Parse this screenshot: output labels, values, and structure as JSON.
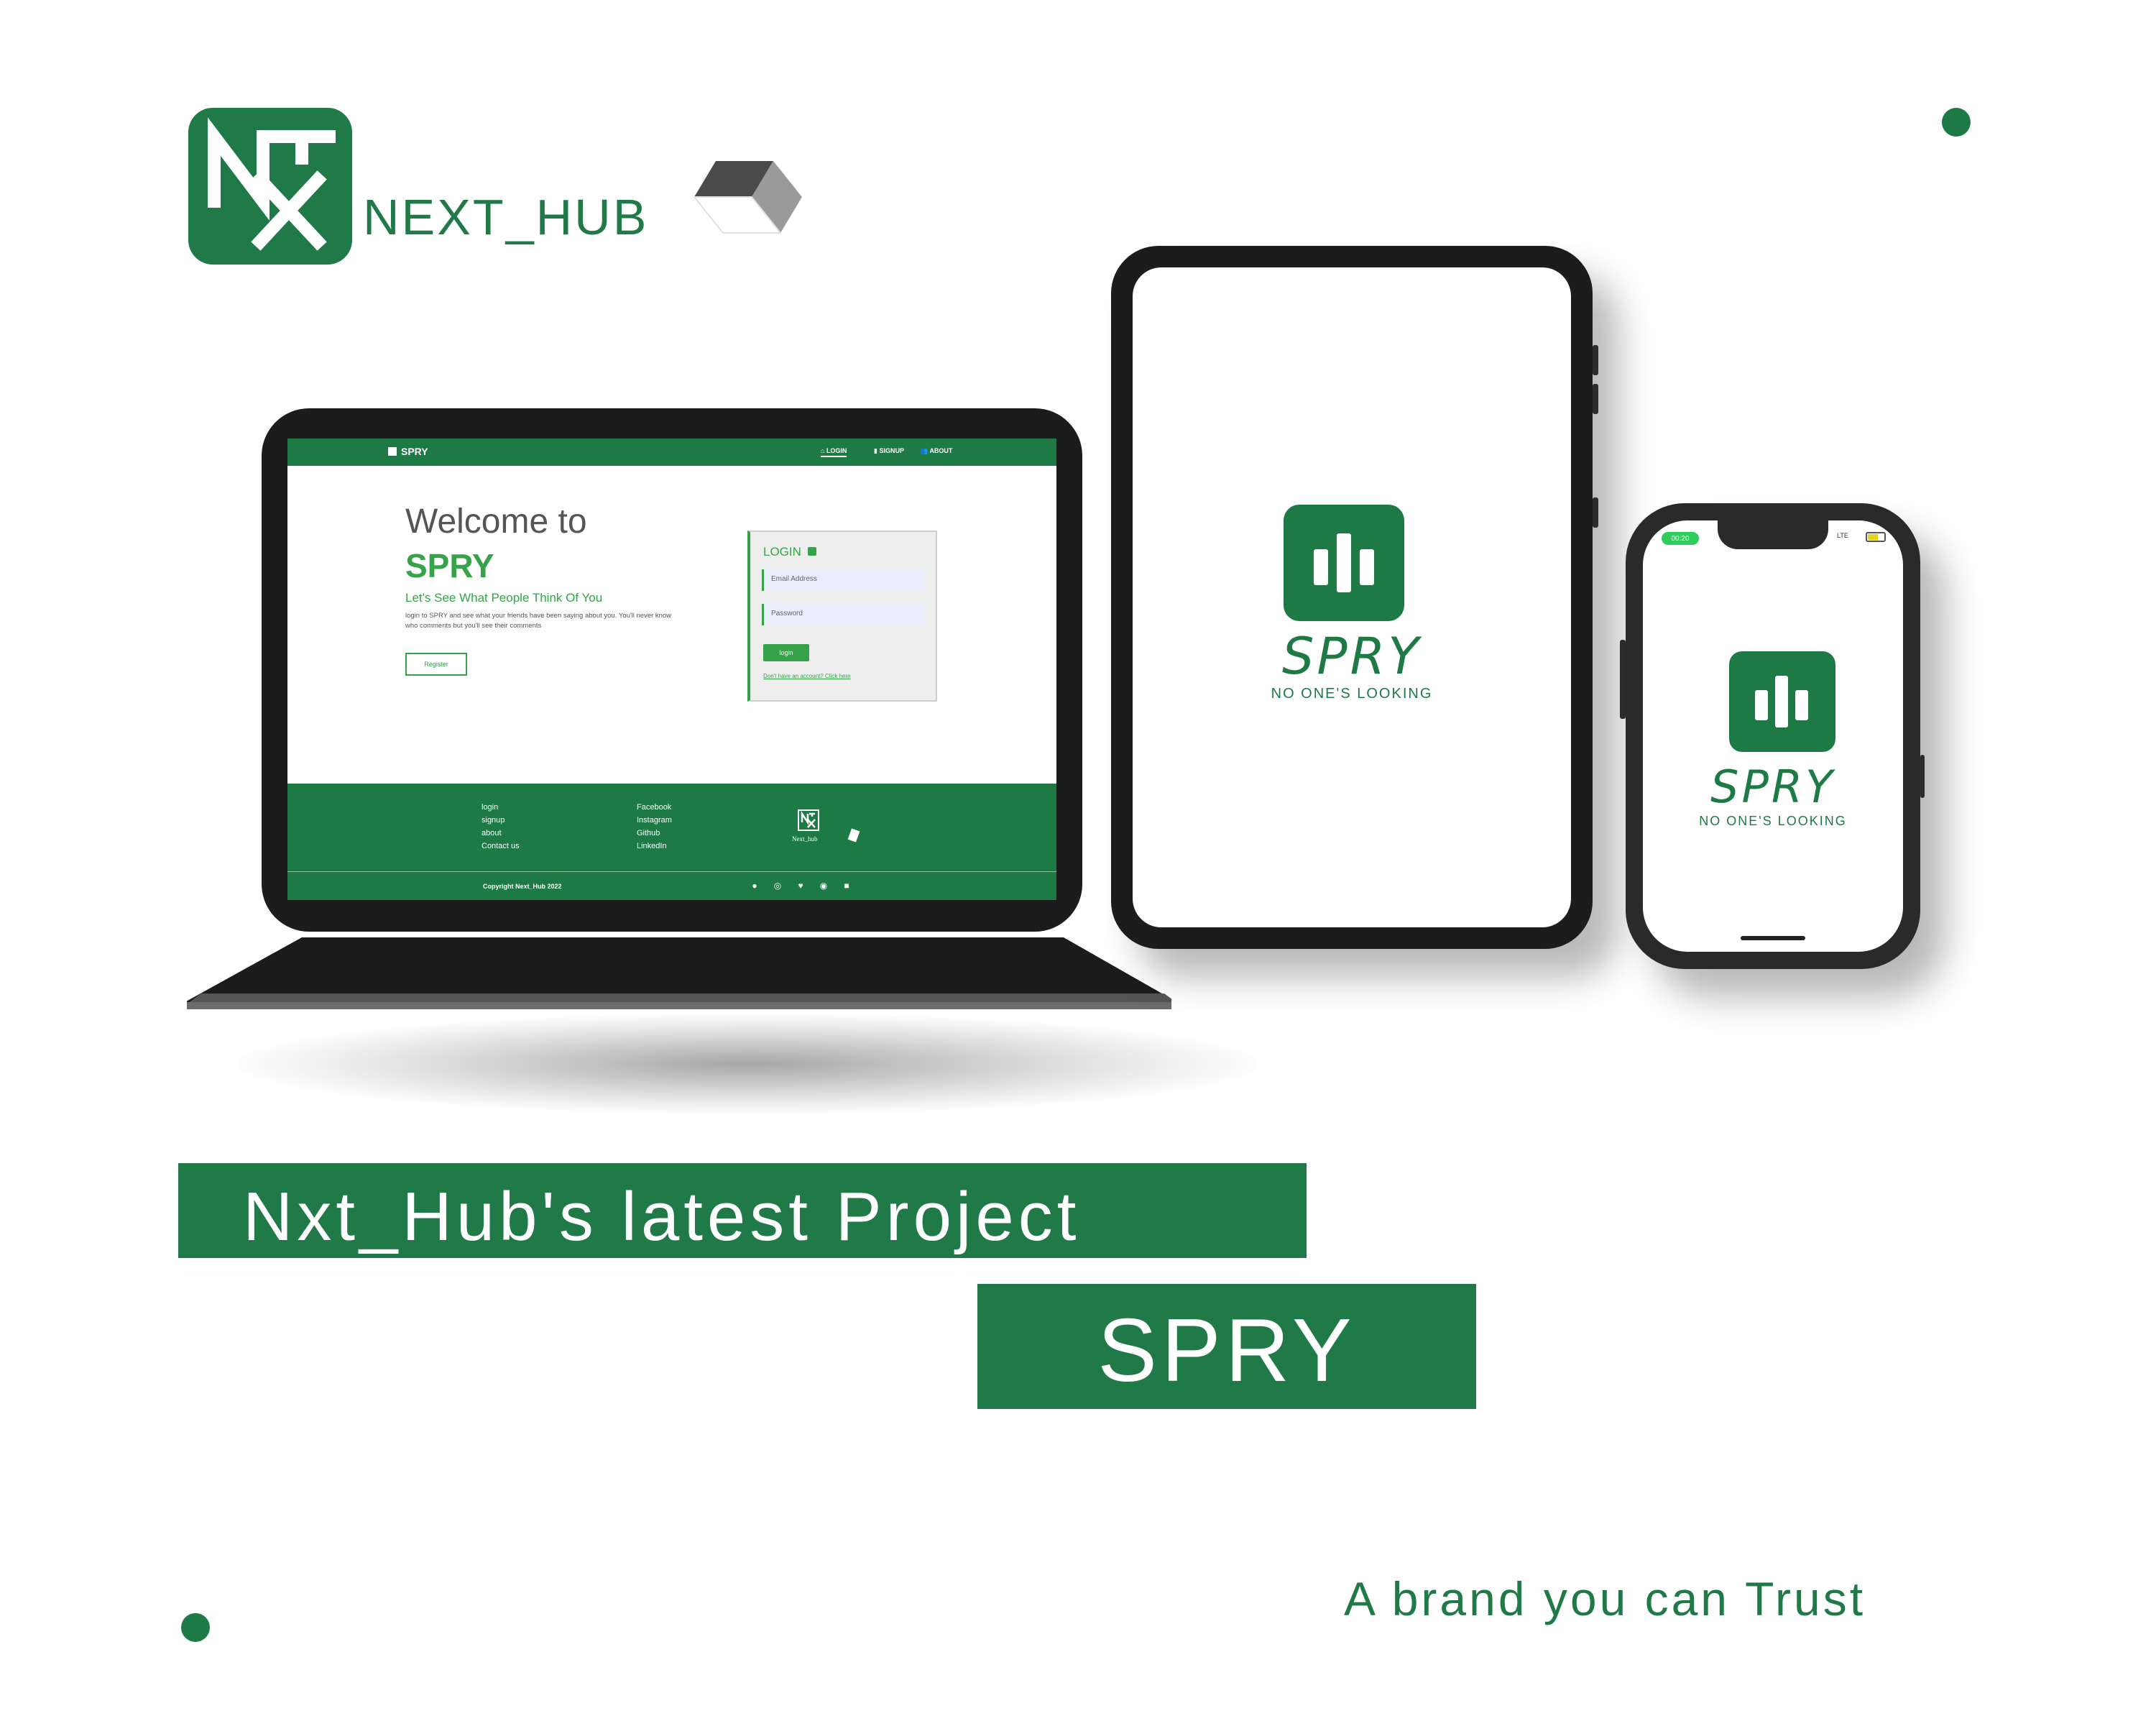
{
  "brand": {
    "logo_text": "NEXT_HUB"
  },
  "laptop_site": {
    "nav": {
      "brand": "SPRY",
      "items": [
        "LOGIN",
        "SIGNUP",
        "ABOUT"
      ]
    },
    "hero": {
      "welcome": "Welcome to",
      "title": "SPRY",
      "tagline": "Let's See What People Think Of You",
      "description": "login to SPRY and see what your friends have been saying about you. You'll never know who comments but you'll see their comments",
      "register_label": "Register"
    },
    "login_card": {
      "title": "LOGIN",
      "email_placeholder": "Email Address",
      "password_placeholder": "Password",
      "button_label": "login",
      "signup_link": "Don't have an account? Click here"
    },
    "footer": {
      "nav_links": [
        "login",
        "signup",
        "about",
        "Contact us"
      ],
      "social_links": [
        "Facebook",
        "Instagram",
        "Github",
        "LinkedIn"
      ],
      "logo_caption": "Next_hub",
      "copyright": "Copyright Next_Hub 2022",
      "social_icons": [
        "facebook-icon",
        "instagram-icon",
        "twitter-icon",
        "github-icon",
        "linkedin-icon"
      ]
    }
  },
  "app_splash": {
    "name": "SPRY",
    "slogan": "NO ONE'S LOOKING"
  },
  "phone_status": {
    "time": "00:20",
    "network": "LTE"
  },
  "headline": {
    "line1": "Nxt_Hub's latest Project",
    "line2": "SPRY"
  },
  "slogan": "A brand you can Trust",
  "colors": {
    "brand_green": "#1f7a47",
    "accent_green": "#36a34a",
    "device_frame": "#1c1c1c"
  }
}
